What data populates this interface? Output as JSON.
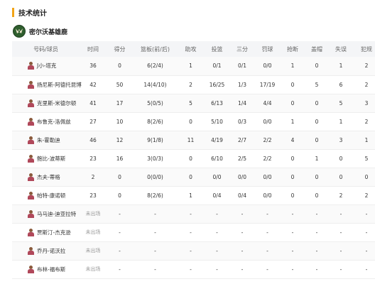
{
  "section": {
    "title": "技术统计",
    "accent_color": "#f2a417"
  },
  "team": {
    "name": "密尔沃基雄鹿",
    "logo_icon": "bucks-logo-icon"
  },
  "columns": [
    "号码/球员",
    "时间",
    "得分",
    "篮板(前/后)",
    "助攻",
    "投篮",
    "三分",
    "罚球",
    "抢断",
    "盖帽",
    "失误",
    "犯规"
  ],
  "players": [
    {
      "name": "J小-塔克",
      "cells": [
        "36",
        "0",
        "6(2/4)",
        "1",
        "0/1",
        "0/1",
        "0/0",
        "1",
        "0",
        "1",
        "2"
      ]
    },
    {
      "name": "扬尼斯-阿德托昆博",
      "cells": [
        "42",
        "50",
        "14(4/10)",
        "2",
        "16/25",
        "1/3",
        "17/19",
        "0",
        "5",
        "6",
        "2"
      ]
    },
    {
      "name": "克里斯-米德尔顿",
      "cells": [
        "41",
        "17",
        "5(0/5)",
        "5",
        "6/13",
        "1/4",
        "4/4",
        "0",
        "0",
        "5",
        "3"
      ]
    },
    {
      "name": "布鲁克-洛佩兹",
      "cells": [
        "27",
        "10",
        "8(2/6)",
        "0",
        "5/10",
        "0/3",
        "0/0",
        "1",
        "0",
        "1",
        "2"
      ]
    },
    {
      "name": "朱-霍勒迪",
      "cells": [
        "46",
        "12",
        "9(1/8)",
        "11",
        "4/19",
        "2/7",
        "2/2",
        "4",
        "0",
        "3",
        "1"
      ]
    },
    {
      "name": "鲍比-波蒂斯",
      "cells": [
        "23",
        "16",
        "3(0/3)",
        "0",
        "6/10",
        "2/5",
        "2/2",
        "0",
        "1",
        "0",
        "5"
      ]
    },
    {
      "name": "杰夫-蒂格",
      "cells": [
        "2",
        "0",
        "0(0/0)",
        "0",
        "0/0",
        "0/0",
        "0/0",
        "0",
        "0",
        "0",
        "0"
      ]
    },
    {
      "name": "帕特-康诺顿",
      "cells": [
        "23",
        "0",
        "8(2/6)",
        "1",
        "0/4",
        "0/4",
        "0/0",
        "0",
        "0",
        "2",
        "2"
      ]
    },
    {
      "name": "马马迪-迪亚拉特",
      "cells": [
        "未出场",
        "-",
        "-",
        "-",
        "-",
        "-",
        "-",
        "-",
        "-",
        "-",
        "-"
      ]
    },
    {
      "name": "贾斯汀-杰克逊",
      "cells": [
        "未出场",
        "-",
        "-",
        "-",
        "-",
        "-",
        "-",
        "-",
        "-",
        "-",
        "-"
      ]
    },
    {
      "name": "乔丹-诺沃拉",
      "cells": [
        "未出场",
        "-",
        "-",
        "-",
        "-",
        "-",
        "-",
        "-",
        "-",
        "-",
        "-"
      ]
    },
    {
      "name": "布林-福布斯",
      "cells": [
        "未出场",
        "-",
        "-",
        "-",
        "-",
        "-",
        "-",
        "-",
        "-",
        "-",
        "-"
      ]
    }
  ]
}
